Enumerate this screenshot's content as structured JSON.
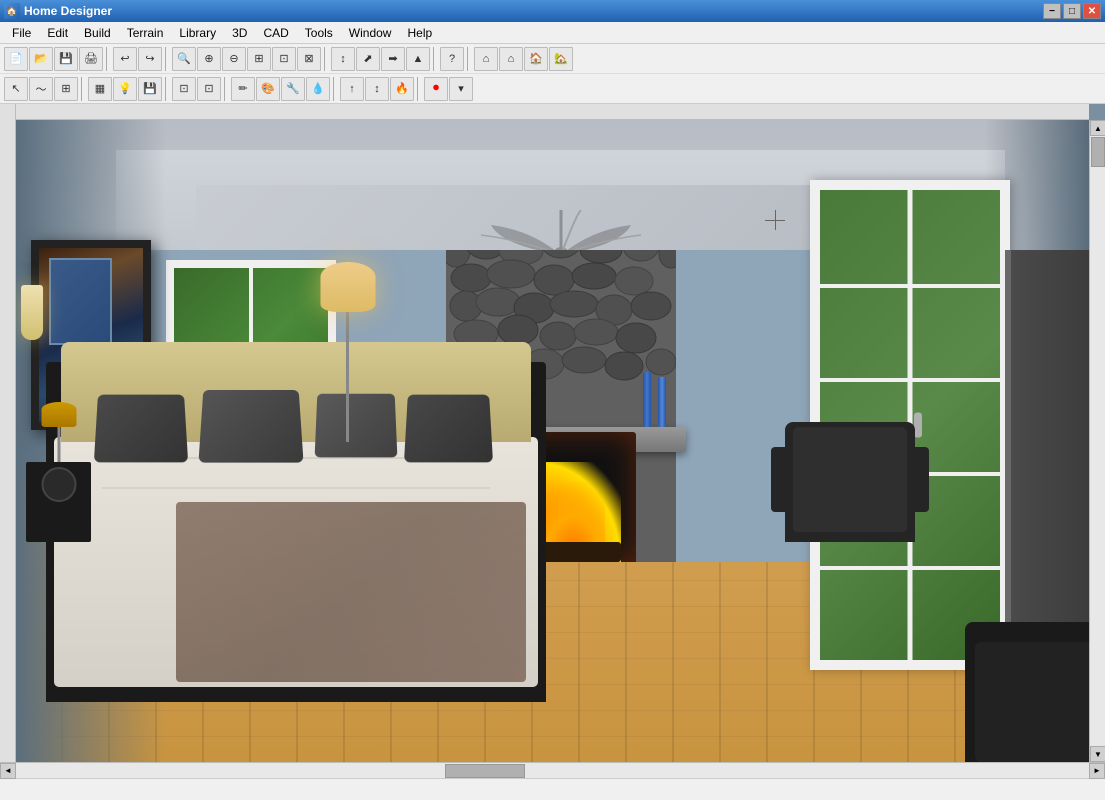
{
  "window": {
    "title": "Home Designer",
    "app_icon": "HD"
  },
  "titlebar": {
    "minimize": "−",
    "maximize": "□",
    "close": "✕"
  },
  "menu": {
    "items": [
      "File",
      "Edit",
      "Build",
      "Terrain",
      "Library",
      "3D",
      "CAD",
      "Tools",
      "Window",
      "Help"
    ]
  },
  "toolbar1": {
    "buttons": [
      "📄",
      "📂",
      "💾",
      "🖨",
      "↩",
      "↪",
      "🔍",
      "🔍+",
      "🔍-",
      "⊞",
      "⊡",
      "⊠",
      "↕",
      "⬈",
      "➡",
      "▲",
      "?",
      "⌂",
      "⌂",
      "🏠",
      "🏡"
    ]
  },
  "toolbar2": {
    "buttons": [
      "↖",
      "〜",
      "⊞",
      "▦",
      "💡",
      "💾",
      "⊡",
      "⊡",
      "✏",
      "🎨",
      "🔧",
      "💧",
      "↑",
      "↕",
      "⏺"
    ]
  },
  "statusbar": {
    "text": ""
  },
  "scene": {
    "type": "3D Interior - Bedroom",
    "elements": [
      "bed",
      "fireplace",
      "windows",
      "artwork",
      "armchair",
      "ceiling fan",
      "hardwood floor",
      "stone wall"
    ]
  }
}
